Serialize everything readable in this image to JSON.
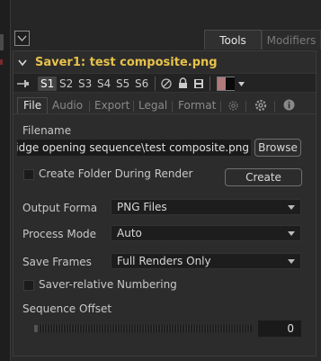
{
  "tabs": {
    "tools": "Tools",
    "modifiers": "Modifiers"
  },
  "tool": {
    "title": "Saver1: test composite.png"
  },
  "toolbar": {
    "slots": [
      "S1",
      "S2",
      "S3",
      "S4",
      "S5",
      "S6"
    ],
    "selected_slot": "S1",
    "swatch_color": "#b07a7a"
  },
  "subtabs": {
    "file": "File",
    "audio": "Audio",
    "export": "Export",
    "legal": "Legal",
    "format": "Format"
  },
  "filename": {
    "label": "Filename",
    "value": "bridge opening sequence\\test composite.png",
    "browse": "Browse"
  },
  "create_folder": {
    "label": "Create Folder During Render",
    "checked": false,
    "button": "Create"
  },
  "output_format": {
    "label": "Output Forma",
    "value": "PNG Files"
  },
  "process_mode": {
    "label": "Process Mode",
    "value": "Auto"
  },
  "save_frames": {
    "label": "Save Frames",
    "value": "Full Renders Only"
  },
  "saver_relative": {
    "label": "Saver-relative Numbering",
    "checked": false
  },
  "sequence_offset": {
    "label": "Sequence Offset",
    "value": "0"
  }
}
